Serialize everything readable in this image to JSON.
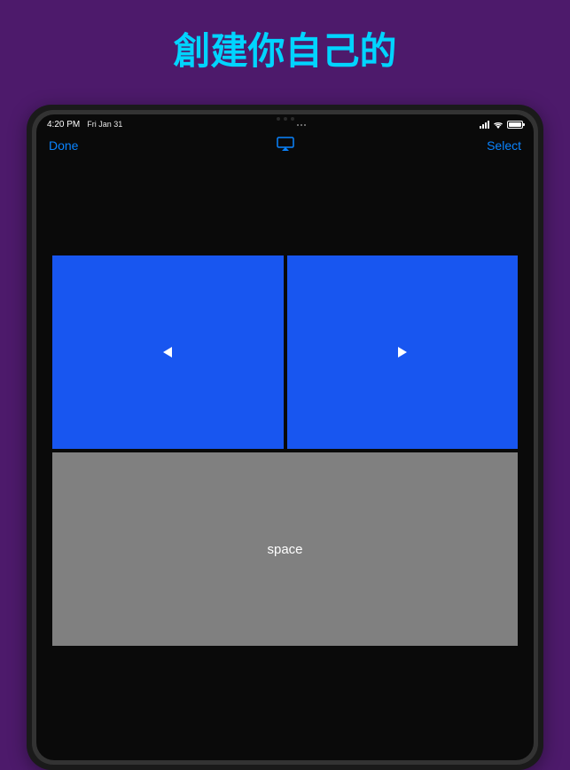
{
  "page": {
    "title": "創建你自己的"
  },
  "status_bar": {
    "time": "4:20 PM",
    "date": "Fri Jan 31"
  },
  "nav": {
    "left_button": "Done",
    "right_button": "Select"
  },
  "buttons": {
    "space_label": "space"
  }
}
